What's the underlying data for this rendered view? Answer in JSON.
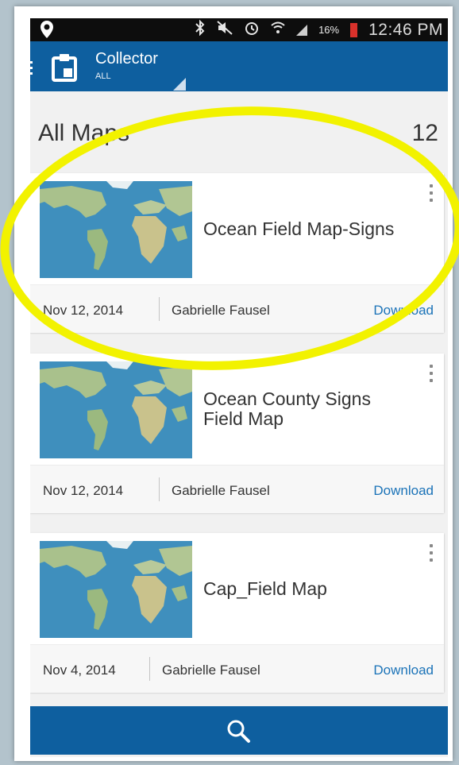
{
  "status_bar": {
    "battery_percent": "16%",
    "time": "12:46 PM"
  },
  "app_bar": {
    "title": "Collector",
    "subtitle": "ALL"
  },
  "section": {
    "title": "All Maps",
    "count": "12"
  },
  "maps": [
    {
      "title": "Ocean Field Map-Signs",
      "date": "Nov 12, 2014",
      "owner": "Gabrielle Fausel",
      "action": "Download"
    },
    {
      "title": "Ocean County Signs Field Map",
      "date": "Nov 12, 2014",
      "owner": "Gabrielle Fausel",
      "action": "Download"
    },
    {
      "title": "Cap_Field Map",
      "date": "Nov 4, 2014",
      "owner": "Gabrielle Fausel",
      "action": "Download"
    }
  ],
  "icons": {
    "location": "location-pin-icon",
    "bluetooth": "bluetooth-icon",
    "mute": "mute-icon",
    "alarm": "alarm-icon",
    "wifi": "wifi-icon",
    "signal": "signal-icon",
    "battery": "battery-icon",
    "menu": "menu-icon",
    "app": "clipboard-icon",
    "more": "more-vertical-icon",
    "search": "search-icon"
  },
  "colors": {
    "app_bar": "#0e5f9f",
    "download_link": "#1b73b8",
    "highlight": "#f2f200",
    "battery_low": "#d9312b"
  }
}
